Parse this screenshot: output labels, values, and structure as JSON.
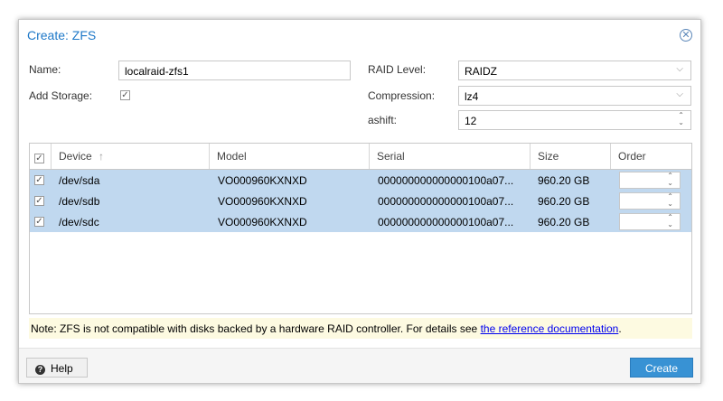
{
  "window": {
    "title": "Create: ZFS"
  },
  "form": {
    "name_label": "Name:",
    "name_value": "localraid-zfs1",
    "add_storage_label": "Add Storage:",
    "raid_level_label": "RAID Level:",
    "raid_level_value": "RAIDZ",
    "compression_label": "Compression:",
    "compression_value": "lz4",
    "ashift_label": "ashift:",
    "ashift_value": "12"
  },
  "grid": {
    "columns": [
      "Device",
      "Model",
      "Serial",
      "Size",
      "Order"
    ],
    "rows": [
      {
        "device": "/dev/sda",
        "model": "VO000960KXNXD",
        "serial": "000000000000000100a07...",
        "size": "960.20 GB"
      },
      {
        "device": "/dev/sdb",
        "model": "VO000960KXNXD",
        "serial": "000000000000000100a07...",
        "size": "960.20 GB"
      },
      {
        "device": "/dev/sdc",
        "model": "VO000960KXNXD",
        "serial": "000000000000000100a07...",
        "size": "960.20 GB"
      }
    ]
  },
  "note": {
    "text": "Note: ZFS is not compatible with disks backed by a hardware RAID controller. For details see ",
    "link_text": "the reference documentation",
    "suffix": "."
  },
  "footer": {
    "help_label": "Help",
    "create_label": "Create"
  },
  "colors": {
    "accent": "#3892d4",
    "selected_row": "#c0d8ef",
    "note_bg": "#fdfae1"
  }
}
